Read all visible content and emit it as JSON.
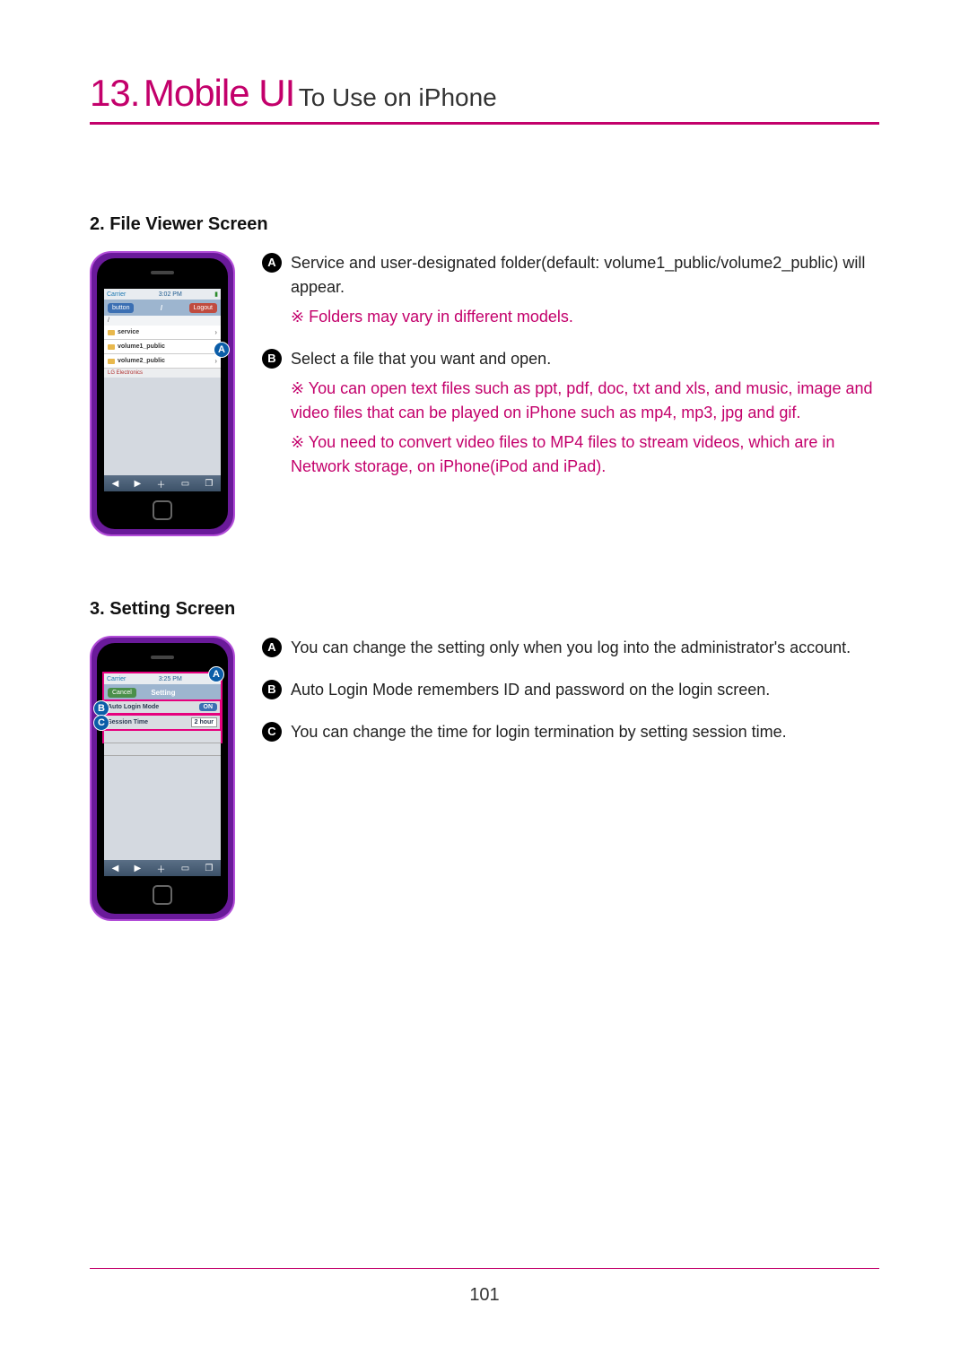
{
  "chapter": {
    "number": "13.",
    "title": "Mobile UI",
    "subtitle": "To Use on iPhone"
  },
  "section2": {
    "heading": "2. File Viewer Screen",
    "phone": {
      "carrier": "Carrier",
      "time": "3:02 PM",
      "backBtn": "button",
      "logoutBtn": "Logout",
      "breadcrumb": "/",
      "rows": [
        "service",
        "volume1_public",
        "volume2_public"
      ],
      "footerBrand": "LG Electronics",
      "calloutA": "A"
    },
    "items": [
      {
        "badge": "A",
        "text": "Service and user-designated folder(default: volume1_public/volume2_public) will appear.",
        "notes": [
          "Folders may vary in different models."
        ]
      },
      {
        "badge": "B",
        "text": "Select a file that you want and open.",
        "notes": [
          "You can open text files such as ppt, pdf, doc, txt and xls, and music, image and video files that can be played on iPhone such as mp4, mp3, jpg and gif.",
          "You need to convert video files to MP4 files to stream videos, which are in Network storage, on iPhone(iPod and iPad)."
        ]
      }
    ]
  },
  "section3": {
    "heading": "3. Setting Screen",
    "phone": {
      "carrier": "Carrier",
      "time": "3:25 PM",
      "cancelBtn": "Cancel",
      "title": "Setting",
      "row1Label": "Auto Login Mode",
      "row1Value": "ON",
      "row2Label": "Session Time",
      "row2Value": "2 hour",
      "calloutA": "A",
      "calloutB": "B",
      "calloutC": "C"
    },
    "items": [
      {
        "badge": "A",
        "text": "You can change the setting only when you log into the administrator's account."
      },
      {
        "badge": "B",
        "text": "Auto Login Mode remembers ID and password on the login screen."
      },
      {
        "badge": "C",
        "text": "You can change the time for login termination by setting session time."
      }
    ]
  },
  "noteMarker": "※",
  "pageNumber": "101"
}
